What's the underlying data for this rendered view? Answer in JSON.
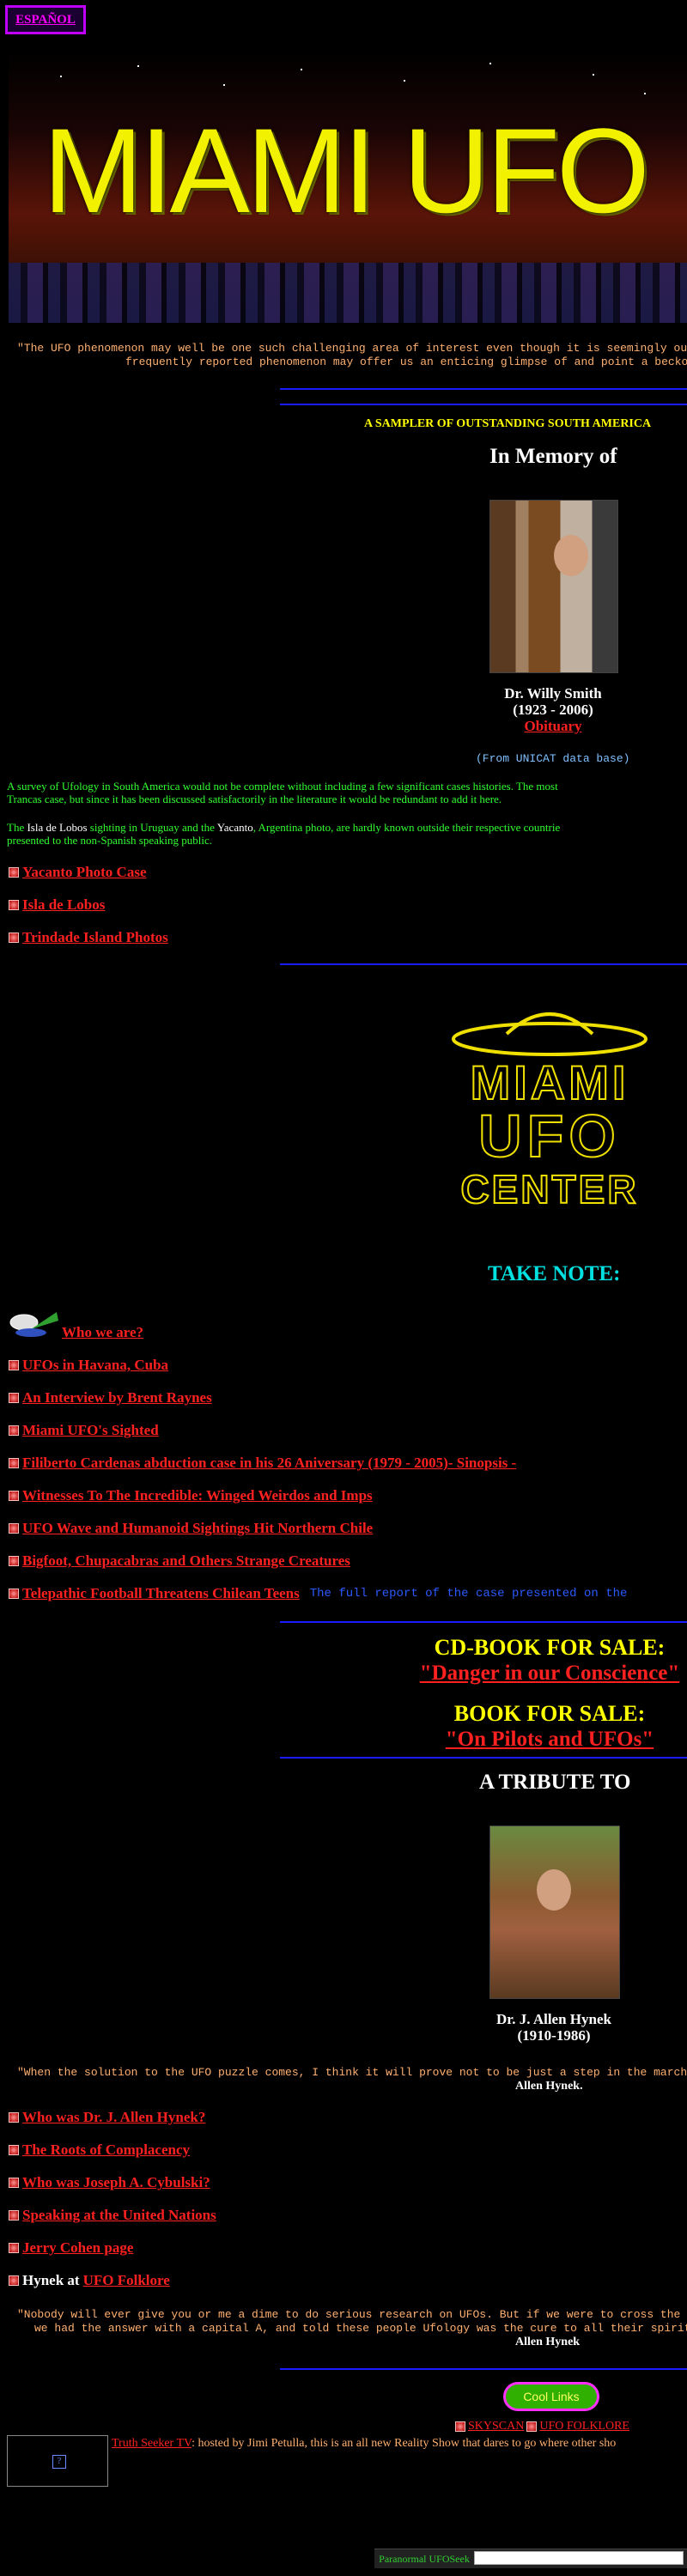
{
  "lang_link": "ESPAÑOL",
  "banner_title": "MIAMI UFO",
  "quote1_line1": "\"The UFO phenomenon may well be one such challenging area of interest even though it is seemingly ou",
  "quote1_line2": "frequently reported phenomenon may offer us an enticing glimpse of and point a becko",
  "sampler_heading": "A SAMPLER OF OUTSTANDING SOUTH AMERICA",
  "memory_heading": "In Memory of",
  "smith": {
    "name": "Dr. Willy Smith",
    "dates": "(1923 - 2006)",
    "obituary": "Obituary",
    "source": "(From UNICAT data base)"
  },
  "survey_text_1": "A survey of Ufology in South America would not be complete without including a few significant cases histories. The most",
  "survey_text_2": "Trancas case, but since it has been discussed satisfactorily in the literature it would be redundant to add it here.",
  "isla_text_1a": "The ",
  "isla_text_1b": "Isla de Lobos",
  "isla_text_1c": " sighting in Uruguay and the ",
  "isla_text_1d": "Yacanto",
  "isla_text_1e": ", Argentina photo, are hardly known outside their respective countrie",
  "isla_text_2": "presented to the non-Spanish speaking public.",
  "sampler_links": [
    "Yacanto Photo Case",
    "Isla de Lobos",
    "Trindade Island Photos"
  ],
  "logo_lines": [
    "MIAMI",
    "UFO",
    "CENTER"
  ],
  "take_note": "TAKE NOTE:",
  "note_links": [
    "Who we are?",
    "UFOs in Havana, Cuba",
    "An Interview by Brent Raynes",
    "Miami UFO's Sighted",
    "Filiberto Cardenas abduction case in his 26 Aniversary (1979 - 2005)- Sinopsis -",
    "Witnesses To The Incredible: Winged Weirdos and Imps",
    "UFO Wave and Humanoid Sightings Hit Northern Chile",
    "Bigfoot, Chupacabras and Others Strange Creatures",
    "Telepathic Football Threatens Chilean Teens"
  ],
  "chile_report_note": "The full report of the case presented on the",
  "cd_sale": "CD-BOOK FOR SALE:",
  "cd_title": "\"Danger in our Conscience\"",
  "book_sale": "BOOK FOR SALE:",
  "book_title": "\"On Pilots and UFOs\"",
  "tribute_heading": "A TRIBUTE TO",
  "hynek": {
    "name": "Dr. J. Allen Hynek",
    "dates": "(1910-1986)"
  },
  "quote2": "\"When the solution to the UFO puzzle comes, I think it will prove not to be just a step in the march",
  "quote2_author": "Allen Hynek.",
  "hynek_links": [
    "Who was Dr. J. Allen Hynek?",
    "The Roots of Complacency",
    "Who was Joseph A. Cybulski?",
    "Speaking at the United Nations",
    "Jerry Cohen page"
  ],
  "hynek_at": "Hynek at ",
  "ufo_folklore": "UFO Folklore",
  "quote3_line1": "\"Nobody will ever give you or me a dime to do serious research on UFOs. But if we were to cross the l",
  "quote3_line2": "we had the answer with a capital A, and told these people Ufology was the cure to all their spiritu",
  "quote3_author": "Allen Hynek",
  "cool_links": "Cool Links",
  "skyscan": "SKYSCAN",
  "ufo_folklore_caps": "UFO FOLKLORE",
  "truth_seeker": "Truth Seeker TV",
  "truth_seeker_desc": ": hosted by Jimi Petulla, this is an all new Reality Show that dares to go where other sho",
  "paranormal_label": "Paranormal UFOSeek"
}
